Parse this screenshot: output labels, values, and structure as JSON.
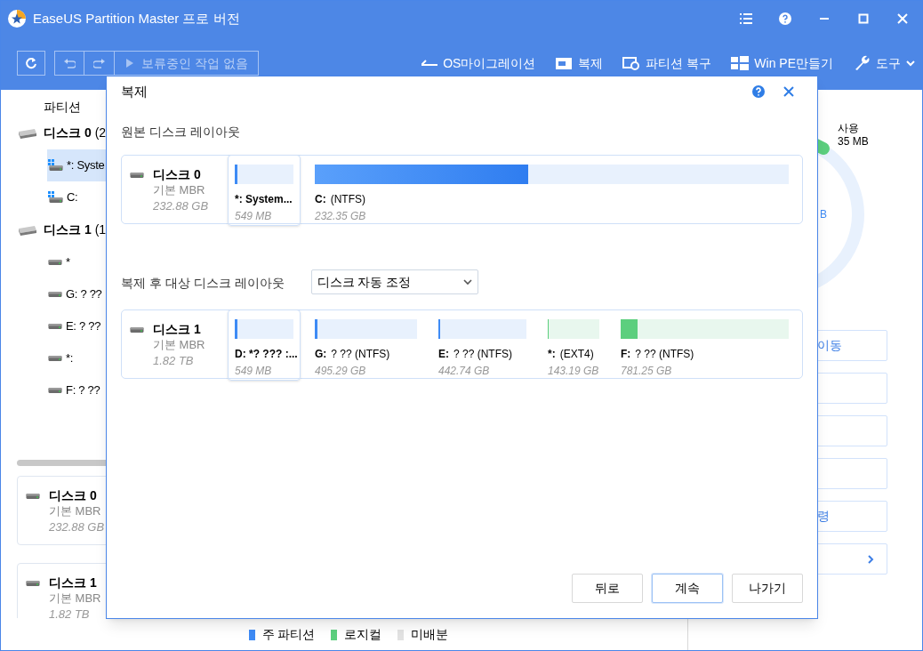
{
  "window": {
    "title": "EaseUS Partition Master 프로 버전"
  },
  "toolbar": {
    "pending": {
      "label": "보류중인 작업 없음",
      "disabled": true
    },
    "items": [
      {
        "label": "OS마이그레이션",
        "kind": "migrate"
      },
      {
        "label": "복제",
        "kind": "clone"
      },
      {
        "label": "파티션 복구",
        "kind": "recover"
      },
      {
        "label": "Win PE만들기",
        "kind": "winpe"
      },
      {
        "label": "도구",
        "kind": "tools"
      }
    ]
  },
  "sidebar": {
    "header": "파티션",
    "tree": [
      {
        "name": "디스크 0",
        "suffix": "(2",
        "children": [
          {
            "label": "*: Syste",
            "kind": "system",
            "selected": true
          },
          {
            "label": "C:",
            "kind": "system",
            "selected": false
          }
        ]
      },
      {
        "name": "디스크 1",
        "suffix": "(1",
        "children": [
          {
            "label": "*",
            "kind": "plain",
            "selected": false
          },
          {
            "label": "G: ? ??",
            "kind": "plain",
            "selected": false
          },
          {
            "label": "E: ? ??",
            "kind": "plain",
            "selected": false
          },
          {
            "label": "*:",
            "kind": "plain",
            "selected": false
          },
          {
            "label": "F: ? ??",
            "kind": "plain",
            "selected": false
          }
        ]
      }
    ]
  },
  "disk_cards": [
    {
      "name": "디스크 0",
      "type": "기본 MBR",
      "size": "232.88 GB"
    },
    {
      "name": "디스크 1",
      "type": "기본 MBR",
      "size": "1.82 TB"
    }
  ],
  "legend": [
    {
      "label": "주 파티션",
      "color": "#3e8bf5"
    },
    {
      "label": "로지컬",
      "color": "#5ccf7e"
    },
    {
      "label": "미배분",
      "color": "#e2e2e2"
    }
  ],
  "usage": {
    "label": "사용",
    "value": "35 MB",
    "fragment": "B"
  },
  "right_actions": [
    {
      "kind": "text",
      "label": "이동"
    },
    {
      "kind": "blank"
    },
    {
      "kind": "blank"
    },
    {
      "kind": "blank"
    },
    {
      "kind": "text",
      "label": "령"
    },
    {
      "kind": "chevron"
    }
  ],
  "dialog": {
    "title": "복제",
    "source": {
      "heading": "원본 디스크 레이아웃",
      "disk": {
        "name": "디스크 0",
        "type": "기본 MBR",
        "size": "232.88 GB"
      },
      "partitions": [
        {
          "drive": "*: System...",
          "size": "549 MB",
          "kind": "primary",
          "level": 0.04,
          "selected": true
        },
        {
          "drive": "C:",
          "label": "(NTFS)",
          "size": "232.35 GB",
          "kind": "primary",
          "level": 0.45,
          "selected": false
        }
      ]
    },
    "target": {
      "heading": "복제 후 대상 디스크 레이아웃",
      "dropdown": "디스크 자동 조정",
      "disk": {
        "name": "디스크 1",
        "type": "기본 MBR",
        "size": "1.82 TB"
      },
      "partitions": [
        {
          "drive": "D: *? ??? :...",
          "size": "549 MB",
          "kind": "primary",
          "level": 0.05,
          "selected": true
        },
        {
          "drive": "G:",
          "label": "? ?? (NTFS)",
          "size": "495.29 GB",
          "kind": "primary",
          "level": 0.03,
          "selected": false
        },
        {
          "drive": "E:",
          "label": "? ?? (NTFS)",
          "size": "442.74 GB",
          "kind": "primary",
          "level": 0.01,
          "selected": false
        },
        {
          "drive": "*:",
          "label": "(EXT4)",
          "size": "143.19 GB",
          "kind": "logical",
          "level": 0.01,
          "selected": false
        },
        {
          "drive": "F:",
          "label": "? ?? (NTFS)",
          "size": "781.25 GB",
          "kind": "logical",
          "level": 0.1,
          "selected": false
        }
      ]
    },
    "buttons": [
      {
        "label": "뒤로",
        "selected": false
      },
      {
        "label": "계속",
        "selected": true
      },
      {
        "label": "나가기",
        "selected": false
      }
    ]
  }
}
